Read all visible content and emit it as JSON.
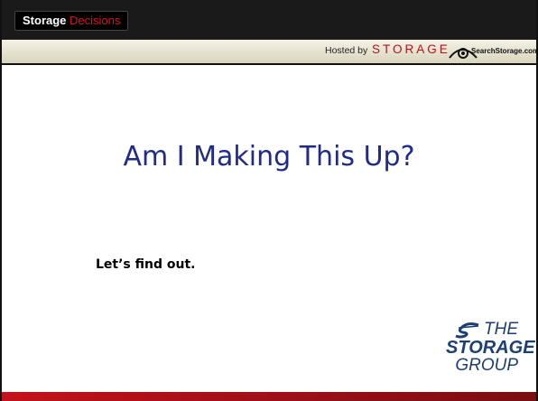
{
  "header": {
    "brand_primary": "Storage",
    "brand_accent": "Decisions",
    "hosted_by": "Hosted by",
    "storage_wordmark": "STORAGE",
    "searchstorage": "SearchStorage.com"
  },
  "slide": {
    "title": "Am I Making This Up?",
    "body": "Let’s find out."
  },
  "footer_logo": {
    "line1": "THE",
    "line2": "STORAGE",
    "line3": "GROUP"
  },
  "colors": {
    "title": "#1e2a8c",
    "brand_accent": "#d8141b",
    "bottom_bar": "#c4121a",
    "logo_blue": "#1d3f78"
  }
}
